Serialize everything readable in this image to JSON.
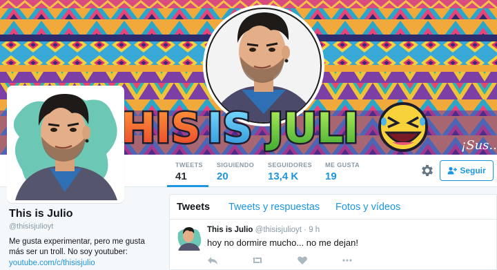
{
  "banner": {
    "title_text": "THIS IS JULIO",
    "signature_text": "¡Sus..."
  },
  "profile": {
    "name": "This is Julio",
    "handle": "@thisisjulioyt",
    "bio": "Me gusta experimentar, pero me gusta más ser un troll. No soy youtuber:",
    "link": "youtube.com/c/thisisjulio"
  },
  "stats": [
    {
      "label": "TWEETS",
      "value": "41"
    },
    {
      "label": "SIGUIENDO",
      "value": "20"
    },
    {
      "label": "SEGUIDORES",
      "value": "13,4 K"
    },
    {
      "label": "ME GUSTA",
      "value": "19"
    }
  ],
  "actions": {
    "follow_label": "Seguir",
    "settings_icon": "gear-icon"
  },
  "timeline": {
    "tabs": [
      "Tweets",
      "Tweets y respuestas",
      "Fotos y vídeos"
    ],
    "tweet": {
      "name": "This is Julio",
      "handle": "@thisisjulioyt",
      "separator": "·",
      "time": "9 h",
      "text": "hoy no dormire mucho... no me dejan!"
    }
  },
  "colors": {
    "accent": "#1b95e0",
    "text": "#14171a",
    "muted": "#8899a6",
    "background": "#f5f8fa"
  }
}
